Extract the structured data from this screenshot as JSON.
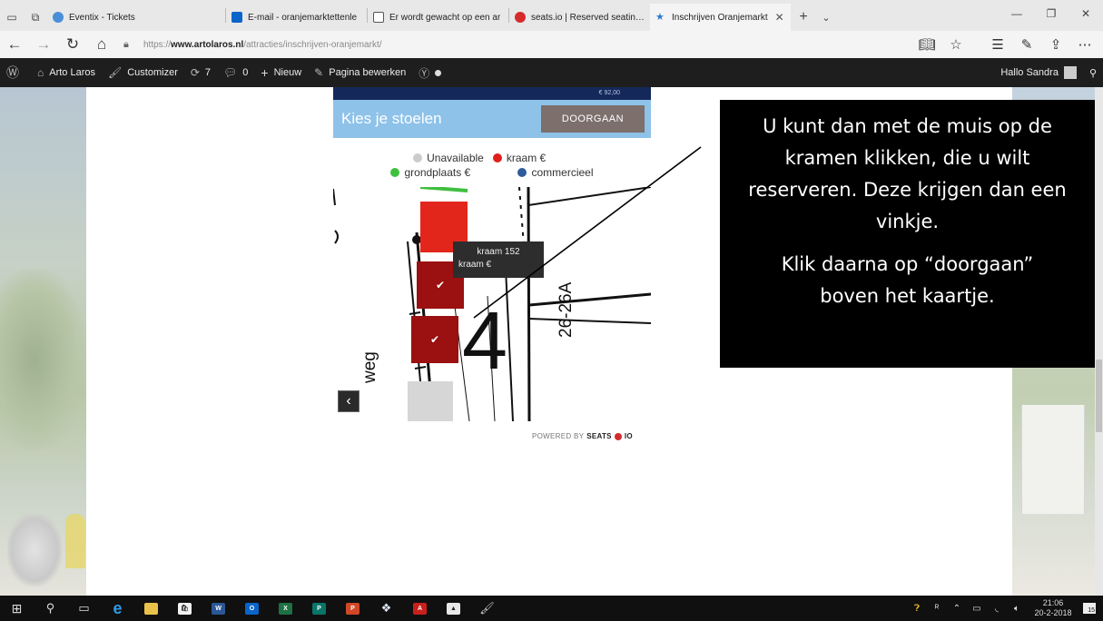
{
  "browser": {
    "tabs": [
      {
        "label": "Eventix - Tickets",
        "icon": "eventix-favicon",
        "color": "#4a8fd8"
      },
      {
        "label": "E-mail - oranjemarktettenle",
        "icon": "outlook-favicon",
        "color": "#0a64c9"
      },
      {
        "label": "Er wordt gewacht op een ar",
        "icon": "page-favicon",
        "color": "#555555"
      },
      {
        "label": "seats.io | Reserved seating f",
        "icon": "seatsio-favicon",
        "color": "#d62b2b"
      },
      {
        "label": "Inschrijven Oranjemarkt",
        "icon": "star-favicon",
        "color": "#2b7bd6",
        "active": true
      }
    ],
    "url_prefix": "https://",
    "url_host": "www.artolaros.nl",
    "url_path": "/attracties/inschrijven-oranjemarkt/"
  },
  "admin_bar": {
    "site_name": "Arto Laros",
    "customizer": "Customizer",
    "updates_count": "7",
    "comments_count": "0",
    "new_label": "Nieuw",
    "edit_page": "Pagina bewerken",
    "greeting": "Hallo Sandra"
  },
  "seatmap": {
    "price_text": "€ 92,00",
    "title": "Kies je stoelen",
    "proceed_button": "DOORGAAN",
    "legend": [
      {
        "label": "Unavailable",
        "color": "#cccccc"
      },
      {
        "label": "kraam €",
        "color": "#e0201b"
      },
      {
        "label": "grondplaats €",
        "color": "#3fbf3f"
      },
      {
        "label": "commercieel",
        "color": "#2e5c9a"
      }
    ],
    "tooltip_line1": "kraam 152",
    "tooltip_line2": "kraam €",
    "map_label": "26-26A",
    "big_number": "4",
    "street_label": "weg",
    "powered_prefix": "POWERED BY",
    "powered_brand_a": "SEATS",
    "powered_brand_b": "IO"
  },
  "instruction": {
    "paragraph1": "U kunt dan met de muis op de kramen klikken, die u wilt reserveren. Deze krijgen dan een vinkje.",
    "paragraph2": "Klik daarna op “doorgaan” boven het kaartje."
  },
  "taskbar": {
    "time": "21:06",
    "date": "20-2-2018",
    "notification_count": "15"
  }
}
